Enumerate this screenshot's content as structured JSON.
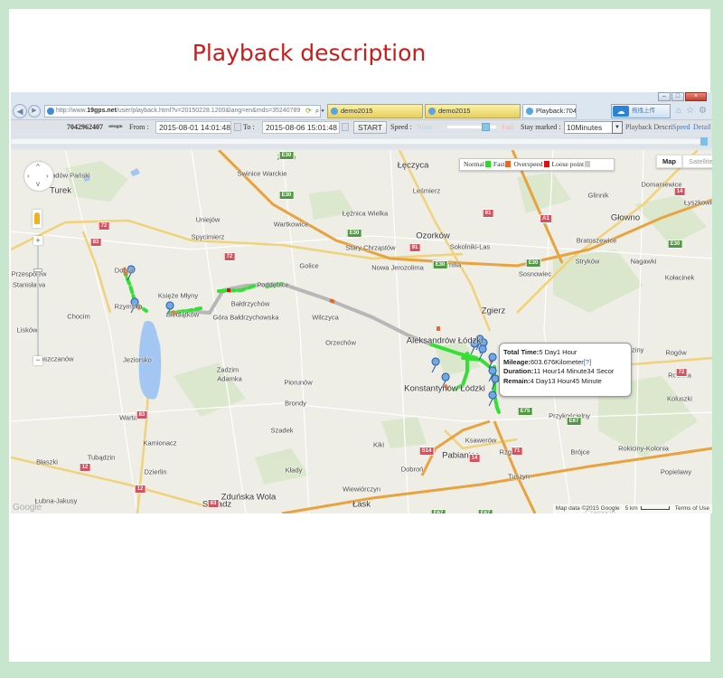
{
  "headline": "Playback description",
  "browser": {
    "window_buttons": [
      "–",
      "□",
      "×"
    ],
    "address_url_prefix": "http://www.",
    "address_url_domain": "19gps.net",
    "address_url_rest": "/user/playback.html?v=20150228.1200&lang=en&mds=35240789",
    "address_tools": [
      "⟳",
      "⌕ ▾",
      "▤",
      "→",
      "✕"
    ],
    "tabs": [
      {
        "label": "demo2015",
        "active": false
      },
      {
        "label": "demo2015",
        "active": false
      },
      {
        "label": "Playback:7042",
        "active": true
      }
    ],
    "extension_label": "拖拽上传",
    "ie_icons": [
      "home-icon",
      "star-icon",
      "gear-icon"
    ]
  },
  "toolbar": {
    "device_id": "7042962407",
    "device_suffix": "sensgm",
    "from_label": "From :",
    "from_value": "2015-08-01 14:01:48",
    "to_label": "To :",
    "to_value": "2015-08-06 15:01:48",
    "start_label": "START",
    "speed_label": "Speed :",
    "slow_label": "Slow",
    "fast_label": "Fast",
    "speed_slider_value_percent": 80,
    "stay_label": "Stay marked :",
    "stay_value": "10Minutes",
    "playback_desc_label": "Playback Description",
    "speed_link": "Speed",
    "detail_link": "Detail",
    "playback_progress_percent": 100
  },
  "map": {
    "legend": [
      {
        "label": "Normal",
        "color": "#22dd22"
      },
      {
        "label": "Fast",
        "color": "#ee6622"
      },
      {
        "label": "Overspeed",
        "color": "#dd1111"
      },
      {
        "label": "Loose point",
        "color": "#cccccc"
      }
    ],
    "map_type_buttons": [
      {
        "label": "Map",
        "selected": true
      },
      {
        "label": "Satellite",
        "selected": false
      }
    ],
    "zoom_in_label": "+",
    "zoom_out_label": "−",
    "info_window": {
      "total_time_label": "Total Time:",
      "total_time_value": "5 Day1 Hour",
      "mileage_label": "Mileage:",
      "mileage_value": "603.676Kilometer",
      "mileage_help": "[?]",
      "duration_label": "Duration:",
      "duration_value": "11 Hour14 Minute34 Secor",
      "remain_label": "Remain:",
      "remain_value": "4 Day13 Hour45 Minute"
    },
    "attribution": {
      "map_data": "Map data ©2015 Google",
      "scale": "5 km",
      "terms": "Terms of Use",
      "logo": "Google"
    },
    "places": [
      {
        "name": "Szadów Pański",
        "big": false
      },
      {
        "name": "Turek",
        "big": true
      },
      {
        "name": "Uniejów",
        "big": false
      },
      {
        "name": "Spycimierz",
        "big": false
      },
      {
        "name": "Zimne",
        "big": false
      },
      {
        "name": "Świnice Warckie",
        "big": false
      },
      {
        "name": "Łęczyca",
        "big": true
      },
      {
        "name": "Leśmierz",
        "big": false
      },
      {
        "name": "Łężnica Wielka",
        "big": false
      },
      {
        "name": "Wartkowice",
        "big": false
      },
      {
        "name": "Ozorków",
        "big": true
      },
      {
        "name": "Stary Chrząstów",
        "big": false
      },
      {
        "name": "Sokolniki-Las",
        "big": false
      },
      {
        "name": "Golice",
        "big": false
      },
      {
        "name": "Nowa Jerozolima",
        "big": false
      },
      {
        "name": "Emilia",
        "big": false
      },
      {
        "name": "Domaniewice",
        "big": false
      },
      {
        "name": "Glinnik",
        "big": false
      },
      {
        "name": "Głowno",
        "big": true
      },
      {
        "name": "Łyszkowice",
        "big": false
      },
      {
        "name": "Bratoszewice",
        "big": false
      },
      {
        "name": "Stryków",
        "big": false
      },
      {
        "name": "Nagawki",
        "big": false
      },
      {
        "name": "Sosnowiec",
        "big": false
      },
      {
        "name": "Kołacinek",
        "big": false
      },
      {
        "name": "Dobra",
        "big": false
      },
      {
        "name": "Przespolew",
        "big": false
      },
      {
        "name": "Stanisława",
        "big": false
      },
      {
        "name": "Rzymsko",
        "big": false
      },
      {
        "name": "Księże Młyny",
        "big": false
      },
      {
        "name": "Siedlątków",
        "big": false
      },
      {
        "name": "Chocim",
        "big": false
      },
      {
        "name": "Lisków",
        "big": false
      },
      {
        "name": "Goszczanów",
        "big": false
      },
      {
        "name": "Jeziorsko",
        "big": false
      },
      {
        "name": "Poddębice",
        "big": false
      },
      {
        "name": "Bałdrzychów",
        "big": false
      },
      {
        "name": "Góra Bałdrzychowska",
        "big": false
      },
      {
        "name": "Wilczyca",
        "big": false
      },
      {
        "name": "Orzechów",
        "big": false
      },
      {
        "name": "Zgierz",
        "big": true
      },
      {
        "name": "Aleksandrów Łódzki",
        "big": true
      },
      {
        "name": "Konstantynów Łódzki",
        "big": true
      },
      {
        "name": "Zadzim",
        "big": false
      },
      {
        "name": "Adamka",
        "big": false
      },
      {
        "name": "Piorunów",
        "big": false
      },
      {
        "name": "Rogów",
        "big": false
      },
      {
        "name": "Brzeziny",
        "big": false
      },
      {
        "name": "Rochna",
        "big": false
      },
      {
        "name": "Koluszki",
        "big": false
      },
      {
        "name": "Przykościelny",
        "big": false
      },
      {
        "name": "Brójce",
        "big": false
      },
      {
        "name": "Rokiciny-Kolonia",
        "big": false
      },
      {
        "name": "Popielawy",
        "big": false
      },
      {
        "name": "Warta",
        "big": false
      },
      {
        "name": "Kamionacz",
        "big": false
      },
      {
        "name": "Błaszki",
        "big": false
      },
      {
        "name": "Tubądzin",
        "big": false
      },
      {
        "name": "Dzierlin",
        "big": false
      },
      {
        "name": "Sieradz",
        "big": true
      },
      {
        "name": "Łubna-Jakusy",
        "big": false
      },
      {
        "name": "Brondy",
        "big": false
      },
      {
        "name": "Szadek",
        "big": false
      },
      {
        "name": "Kiki",
        "big": false
      },
      {
        "name": "Kłady",
        "big": false
      },
      {
        "name": "Dobroń",
        "big": false
      },
      {
        "name": "Zduńska Wola",
        "big": true
      },
      {
        "name": "Wiewiórczyn",
        "big": false
      },
      {
        "name": "Łask",
        "big": true
      },
      {
        "name": "Pabianice",
        "big": true
      },
      {
        "name": "Ksawerów",
        "big": false
      },
      {
        "name": "Rzgów",
        "big": false
      },
      {
        "name": "Tuszyn",
        "big": false
      },
      {
        "name": "Czarnocin",
        "big": false
      }
    ],
    "road_shields": [
      {
        "label": "E30",
        "type": "green"
      },
      {
        "label": "E30",
        "type": "green"
      },
      {
        "label": "E30",
        "type": "green"
      },
      {
        "label": "E30",
        "type": "green"
      },
      {
        "label": "E30",
        "type": "green"
      },
      {
        "label": "E30",
        "type": "green"
      },
      {
        "label": "72",
        "type": "red"
      },
      {
        "label": "72",
        "type": "red"
      },
      {
        "label": "72",
        "type": "red"
      },
      {
        "label": "83",
        "type": "red"
      },
      {
        "label": "83",
        "type": "red"
      },
      {
        "label": "83",
        "type": "red"
      },
      {
        "label": "91",
        "type": "red"
      },
      {
        "label": "91",
        "type": "red"
      },
      {
        "label": "A1",
        "type": "red"
      },
      {
        "label": "14",
        "type": "red"
      },
      {
        "label": "14",
        "type": "red"
      },
      {
        "label": "12",
        "type": "red"
      },
      {
        "label": "12",
        "type": "red"
      },
      {
        "label": "S14",
        "type": "red"
      },
      {
        "label": "71",
        "type": "red"
      },
      {
        "label": "E75",
        "type": "green"
      },
      {
        "label": "E67",
        "type": "green"
      },
      {
        "label": "E67",
        "type": "green"
      },
      {
        "label": "E67",
        "type": "green"
      }
    ]
  }
}
